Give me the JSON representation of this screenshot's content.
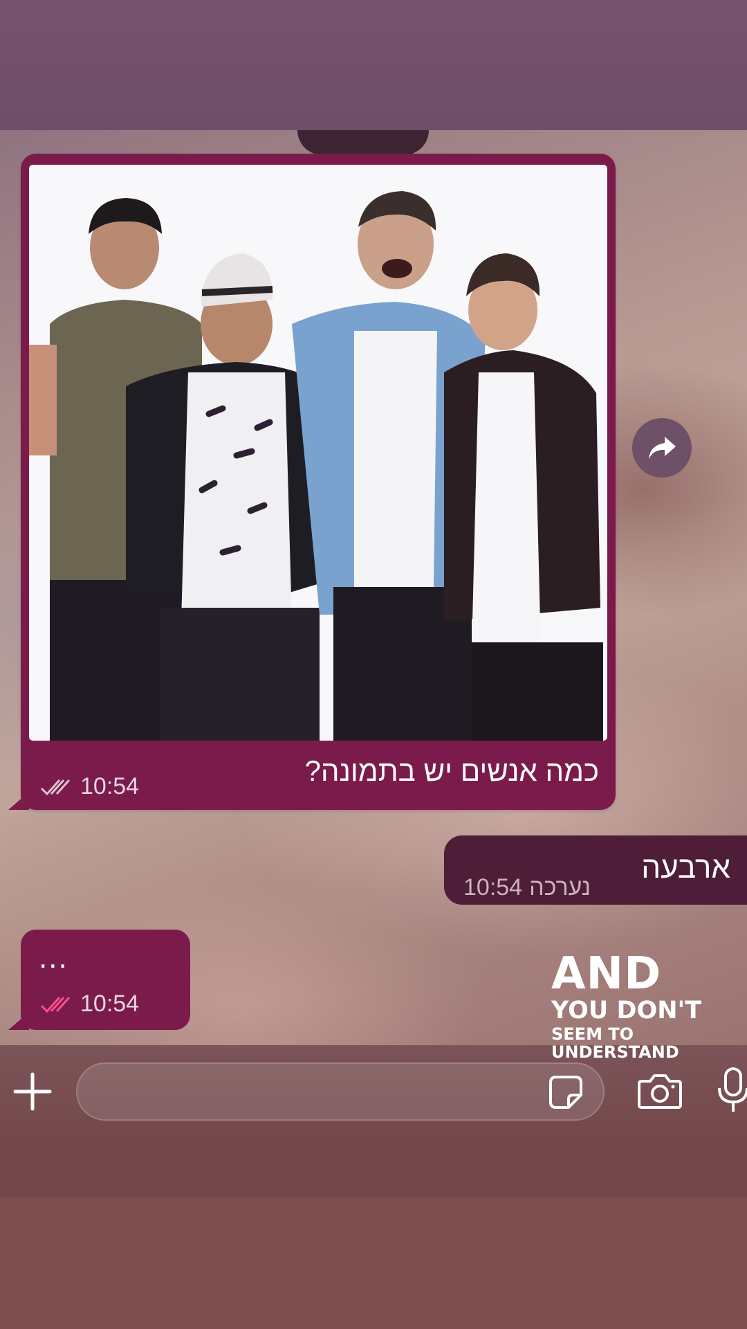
{
  "messages": {
    "incoming_image": {
      "caption": "כמה אנשים יש בתמונה?",
      "time": "10:54"
    },
    "outgoing": {
      "text": "ארבעה",
      "edited_label": "נערכה",
      "time": "10:54"
    },
    "incoming_text": {
      "text": "...",
      "time": "10:54"
    }
  },
  "sticker": {
    "line1": "AND",
    "line2": "YOU DON'T",
    "line3": "SEEM TO",
    "line4": "UNDERSTAND"
  },
  "input": {
    "placeholder": ""
  },
  "icons": {
    "forward": "forward-arrow-icon",
    "attach": "plus-icon",
    "sticker": "sticker-icon",
    "camera": "camera-icon",
    "microphone": "microphone-icon",
    "read_receipt": "double-check-icon"
  },
  "colors": {
    "bubble_incoming": "#7b1b4b",
    "bubble_outgoing": "#4e1d38",
    "read_tick_gray": "#d9c4cf",
    "read_tick_pink": "#ff4f8b"
  }
}
